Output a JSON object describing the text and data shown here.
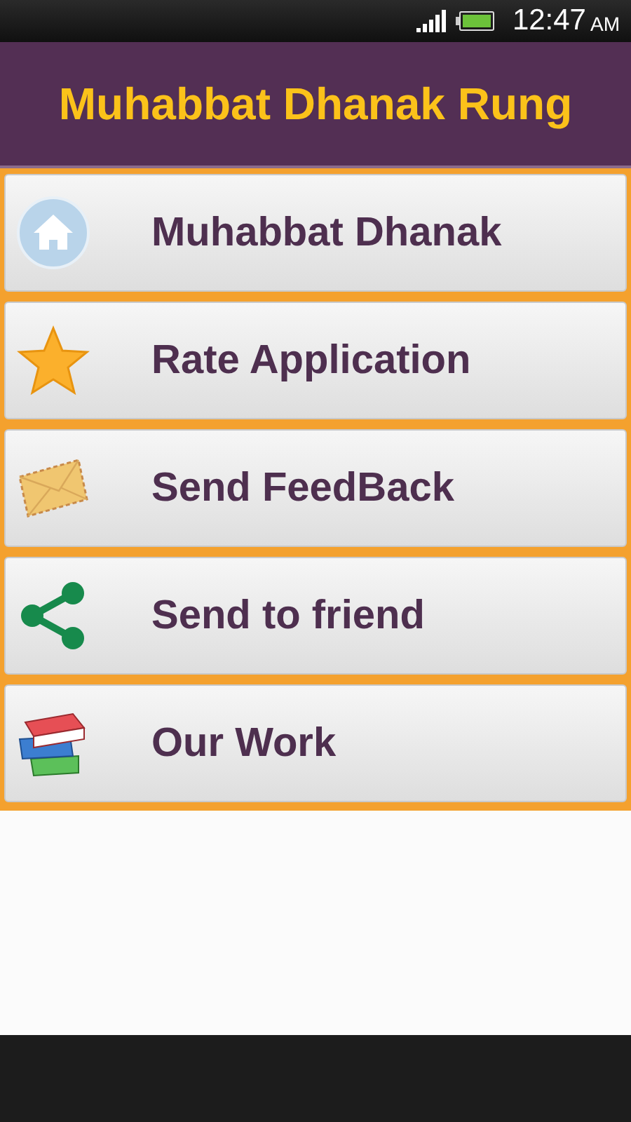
{
  "status_bar": {
    "time": "12:47",
    "meridiem": "AM"
  },
  "header": {
    "title": "Muhabbat Dhanak Rung"
  },
  "menu": [
    {
      "label": "Muhabbat Dhanak"
    },
    {
      "label": "Rate Application"
    },
    {
      "label": "Send FeedBack"
    },
    {
      "label": "Send to friend"
    },
    {
      "label": "Our Work"
    }
  ]
}
